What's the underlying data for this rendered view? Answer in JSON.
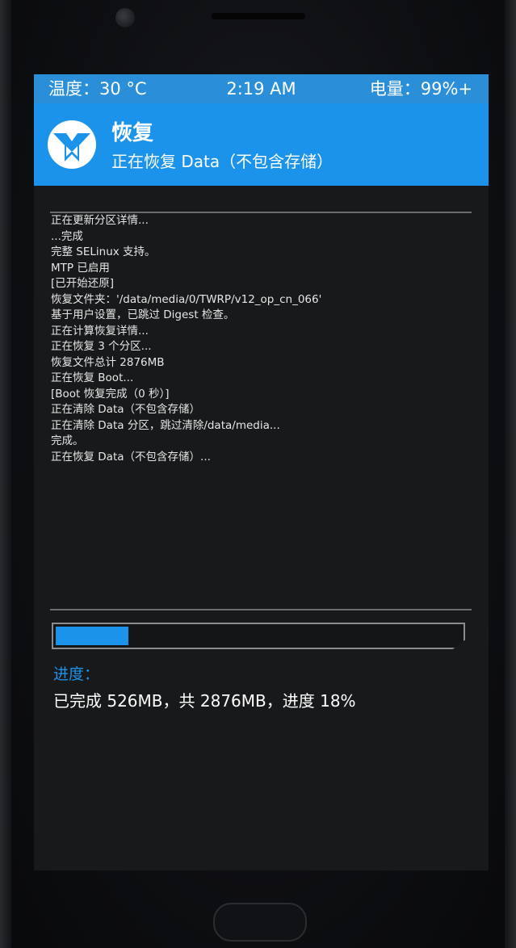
{
  "status_bar": {
    "temperature": "温度：30 °C",
    "time": "2:19 AM",
    "battery": "电量：99%+"
  },
  "header": {
    "title": "恢复",
    "subtitle": "正在恢复 Data（不包含存储）",
    "logo_icon": "twrp-logo-icon",
    "accent_color": "#1c93ea"
  },
  "log": [
    "正在更新分区详情...",
    "...完成",
    "完整 SELinux 支持。",
    "MTP 已启用",
    "[已开始还原]",
    "恢复文件夹：'/data/media/0/TWRP/v12_op_cn_066'",
    "基于用户设置，已跳过 Digest 检查。",
    "正在计算恢复详情...",
    "正在恢复 3 个分区...",
    "恢复文件总计 2876MB",
    "正在恢复 Boot...",
    "[Boot 恢复完成（0 秒）]",
    "正在清除 Data（不包含存储）",
    "正在清除 Data 分区，跳过清除/data/media...",
    "完成。",
    "正在恢复 Data（不包含存储）..."
  ],
  "progress": {
    "label": "进度：",
    "text": "已完成 526MB，共 2876MB，进度 18%",
    "fraction": 0.18
  }
}
